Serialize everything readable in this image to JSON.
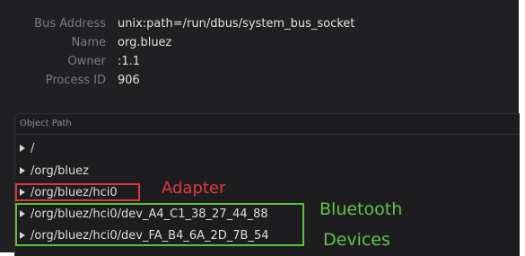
{
  "info": [
    {
      "label": "Bus Address",
      "value": "unix:path=/run/dbus/system_bus_socket"
    },
    {
      "label": "Name",
      "value": "org.bluez"
    },
    {
      "label": "Owner",
      "value": ":1.1"
    },
    {
      "label": "Process ID",
      "value": "906"
    }
  ],
  "object_path_header": "Object Path",
  "tree": [
    {
      "path": "/"
    },
    {
      "path": "/org/bluez"
    },
    {
      "path": "/org/bluez/hci0"
    },
    {
      "path": "/org/bluez/hci0/dev_A4_C1_38_27_44_88"
    },
    {
      "path": "/org/bluez/hci0/dev_FA_B4_6A_2D_7B_54"
    }
  ],
  "annotations": {
    "adapter": "Adapter",
    "devices_line1": "Bluetooth",
    "devices_line2": "Devices"
  },
  "colors": {
    "background": "#202022",
    "annotation_red": "#e2393e",
    "annotation_green": "#63c24a"
  },
  "icons": {
    "tree_expander": "disclosure-triangle-right"
  }
}
